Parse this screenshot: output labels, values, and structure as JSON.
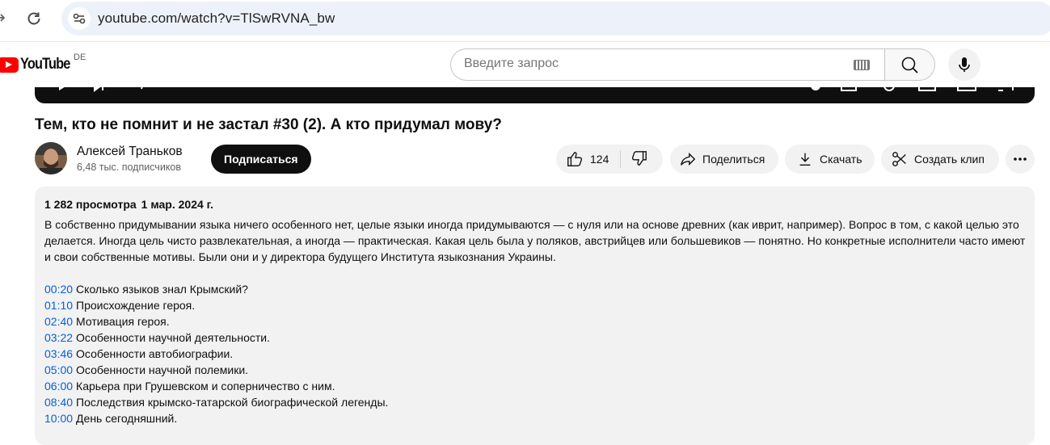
{
  "browser": {
    "url": "youtube.com/watch?v=TlSwRVNA_bw"
  },
  "header": {
    "logo_text": "YouTube",
    "country": "DE",
    "search_placeholder": "Введите запрос"
  },
  "video": {
    "title": "Тем, кто не помнит и не застал #30 (2). А кто придумал мову?",
    "channel_name": "Алексей Траньков",
    "subscribers": "6,48 тыс. подписчиков",
    "subscribe_label": "Подписаться",
    "likes": "124",
    "share_label": "Поделиться",
    "download_label": "Скачать",
    "clip_label": "Создать клип"
  },
  "description": {
    "views": "1 282 просмотра",
    "date": "1 мар. 2024 г.",
    "text": "В собственно придумывании языка ничего особенного нет, целые языки иногда придумываются — с нуля или на основе древних (как иврит, например). Вопрос в том, с какой целью это делается. Иногда цель чисто развлекательная, а иногда — практическая. Какая цель была у поляков, австрийцев или большевиков — понятно. Но конкретные исполнители часто имеют и свои собственные мотивы. Были они и у директора будущего Института языкознания Украины.",
    "chapters": [
      {
        "time": "00:20",
        "title": "Сколько языков знал Крымский?"
      },
      {
        "time": "01:10",
        "title": "Происхождение героя."
      },
      {
        "time": "02:40",
        "title": "Мотивация героя."
      },
      {
        "time": "03:22",
        "title": "Особенности научной деятельности."
      },
      {
        "time": "03:46",
        "title": "Особенности автобиографии."
      },
      {
        "time": "05:00",
        "title": "Особенности научной полемики."
      },
      {
        "time": "06:00",
        "title": "Карьера при Грушевском и соперничество с ним."
      },
      {
        "time": "08:40",
        "title": "Последствия крымско-татарской биографической легенды."
      },
      {
        "time": "10:00",
        "title": "День сегодняшний."
      }
    ]
  },
  "colors": {
    "accent_red": "#ff0000",
    "link_blue": "#065fd4",
    "pill_bg": "#f2f2f2"
  }
}
